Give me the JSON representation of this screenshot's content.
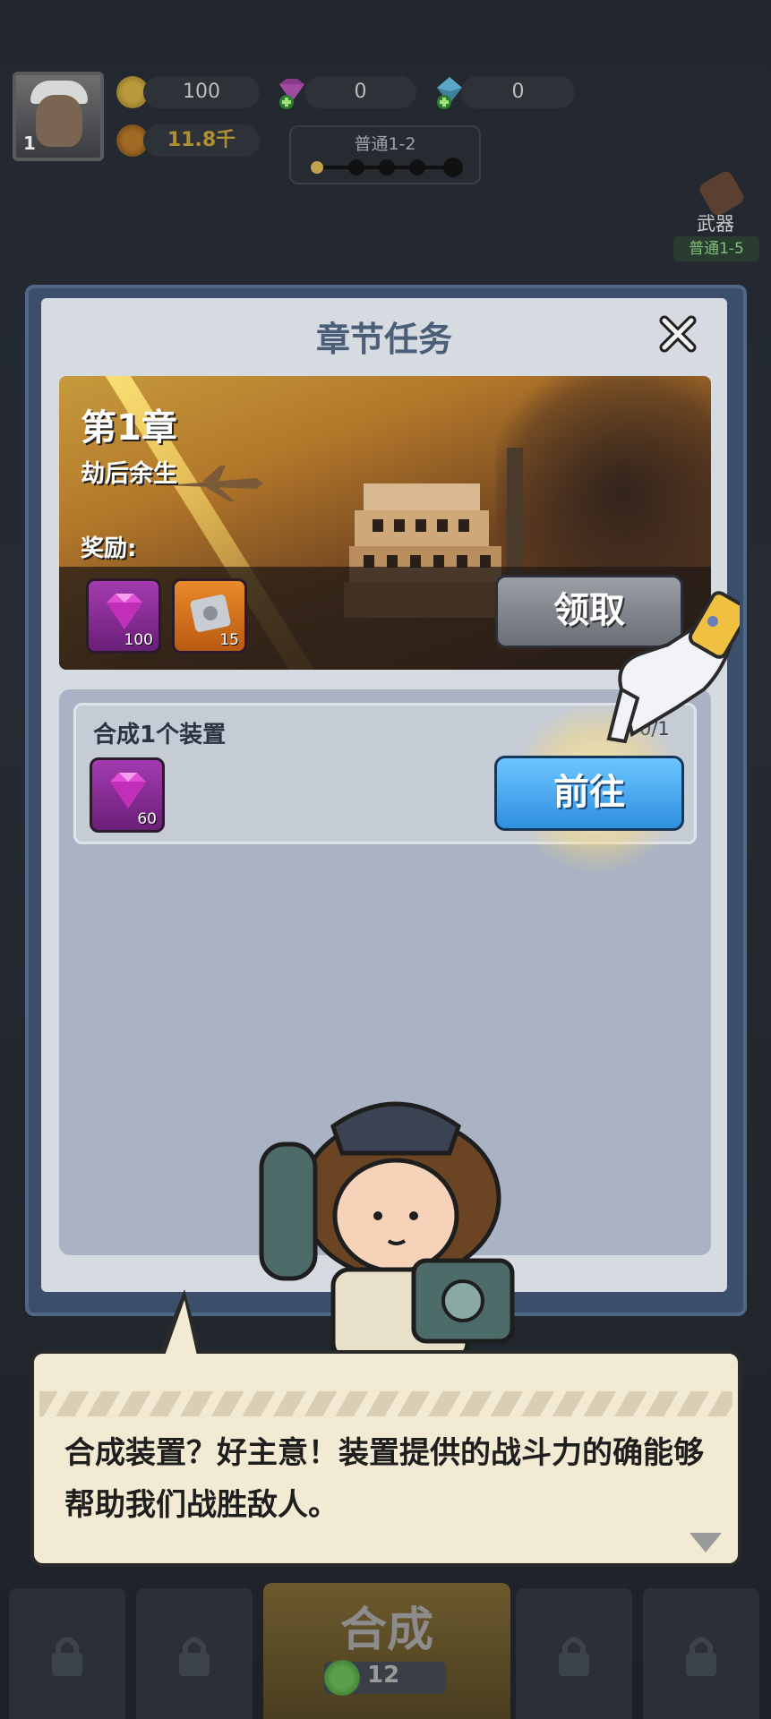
{
  "hud": {
    "avatar_level": "1",
    "coins": "100",
    "gems": "0",
    "crystals": "0",
    "power": "11.8千",
    "stage": "普通1-2"
  },
  "weapon": {
    "label": "武器",
    "stage": "普通1-5"
  },
  "modal": {
    "title": "章节任务",
    "chapter_number": "第1章",
    "chapter_name": "劫后余生",
    "reward_label": "奖励:",
    "rewards": [
      {
        "icon": "gem-icon",
        "qty": "100",
        "color": "#a33bb0"
      },
      {
        "icon": "scroll-icon",
        "qty": "15",
        "color": "#e98a2a"
      }
    ],
    "claim_label": "领取",
    "task": {
      "title": "合成1个装置",
      "progress": "0/1",
      "reward_qty": "60",
      "goto_label": "前往"
    }
  },
  "dialog": {
    "text": "合成装置？好主意！装置提供的战斗力的确能够帮助我们战胜敌人。"
  },
  "bottom": {
    "merge_label": "合成",
    "merge_cost": "12"
  },
  "colors": {
    "accent_blue": "#2f8fe0",
    "gem_purple": "#a33bb0",
    "modal_bg": "#d6dbe2"
  }
}
